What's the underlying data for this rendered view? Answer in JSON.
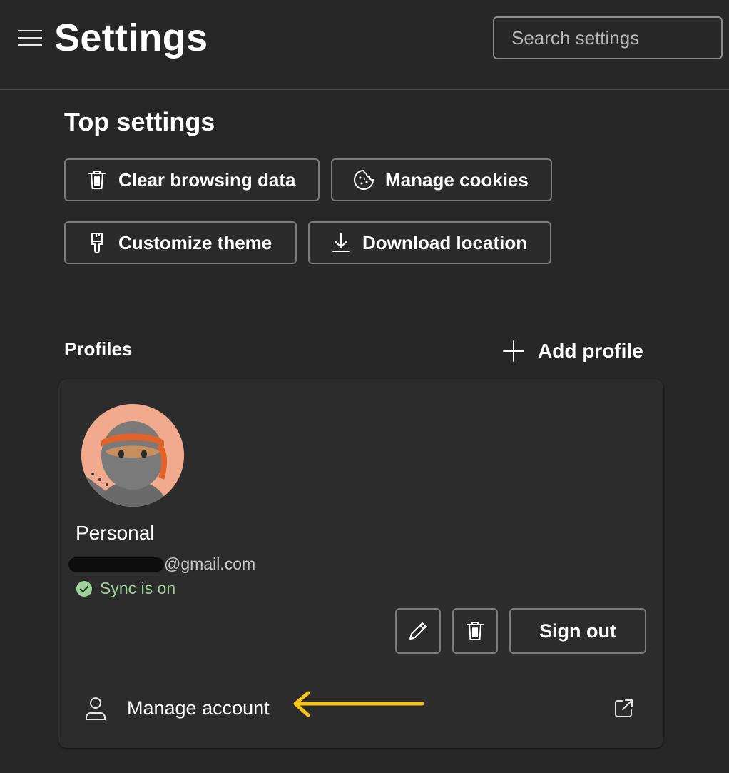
{
  "header": {
    "title": "Settings",
    "search_placeholder": "Search settings"
  },
  "top_settings": {
    "title": "Top settings",
    "buttons": [
      {
        "label": "Clear browsing data",
        "icon": "trash-icon"
      },
      {
        "label": "Manage cookies",
        "icon": "cookie-icon"
      },
      {
        "label": "Customize theme",
        "icon": "paintbrush-icon"
      },
      {
        "label": "Download location",
        "icon": "download-icon"
      }
    ]
  },
  "profiles": {
    "label": "Profiles",
    "add_label": "Add profile",
    "card": {
      "name": "Personal",
      "email_domain": "@gmail.com",
      "sync_status": "Sync is on",
      "sign_out_label": "Sign out",
      "manage_account_label": "Manage account"
    }
  },
  "colors": {
    "background": "#272727",
    "card": "#2c2c2c",
    "sync_green": "#9fd29a",
    "annotation_arrow": "#f5c518"
  }
}
